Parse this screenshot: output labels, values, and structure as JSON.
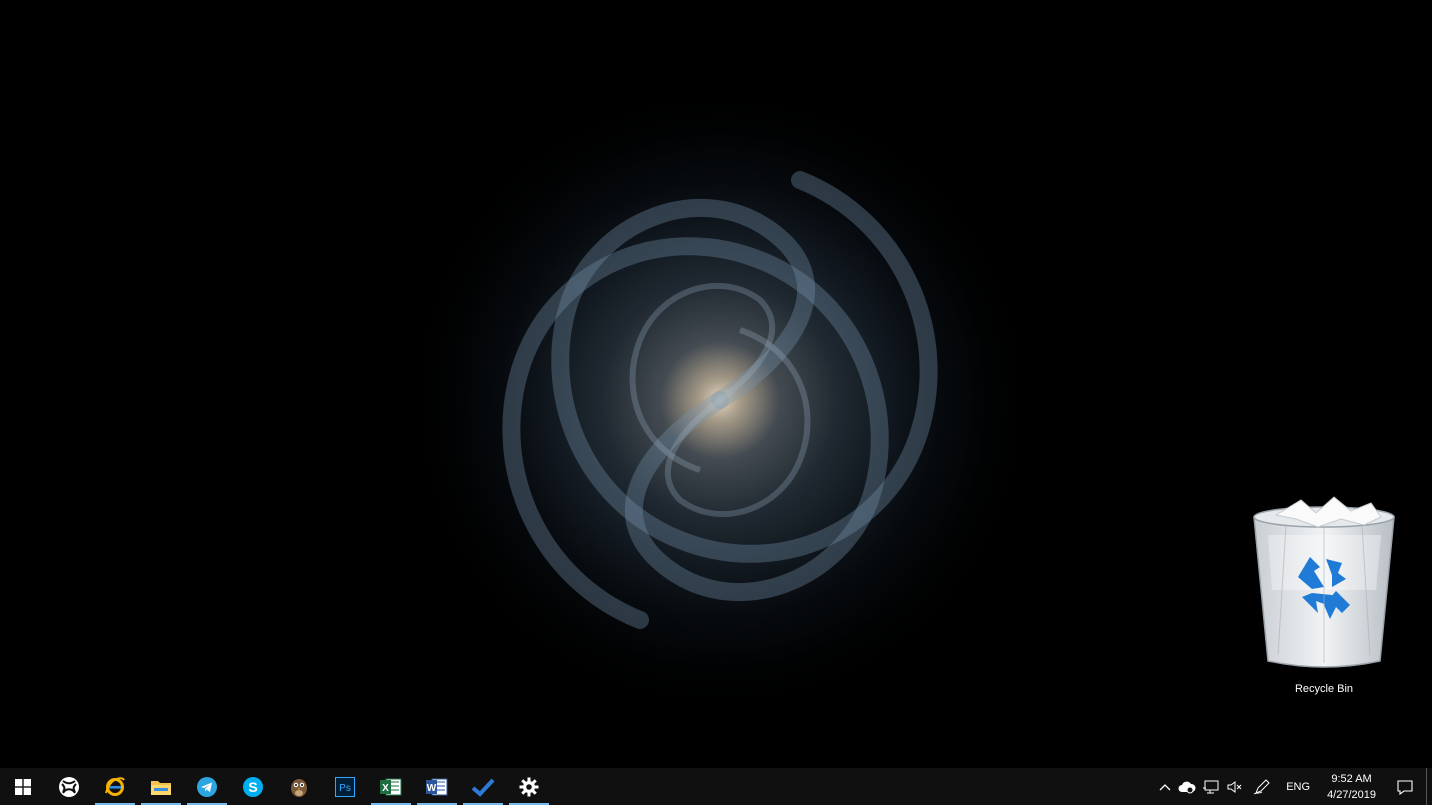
{
  "desktop": {
    "icons": [
      {
        "label": "Recycle Bin"
      }
    ]
  },
  "taskbar": {
    "apps": [
      {
        "name": "Start",
        "running": false
      },
      {
        "name": "Xbox",
        "running": false
      },
      {
        "name": "Internet Explorer",
        "running": true
      },
      {
        "name": "File Explorer",
        "running": true
      },
      {
        "name": "Telegram",
        "running": true
      },
      {
        "name": "Skype",
        "running": false
      },
      {
        "name": "Bird app",
        "running": false
      },
      {
        "name": "Photoshop",
        "running": false
      },
      {
        "name": "Excel",
        "running": true
      },
      {
        "name": "Word",
        "running": true
      },
      {
        "name": "To-Do",
        "running": true
      },
      {
        "name": "Settings",
        "running": true
      }
    ],
    "icon_labels": {
      "photoshop": "Ps",
      "excel": "X",
      "word": "W",
      "skype": "S"
    },
    "tray": {
      "language": "ENG",
      "time": "9:52 AM",
      "date": "4/27/2019"
    }
  },
  "colors": {
    "taskbar_bg": "#101010",
    "running_indicator": "#76b9ed",
    "recycle_arrows": "#1f7bd6"
  }
}
